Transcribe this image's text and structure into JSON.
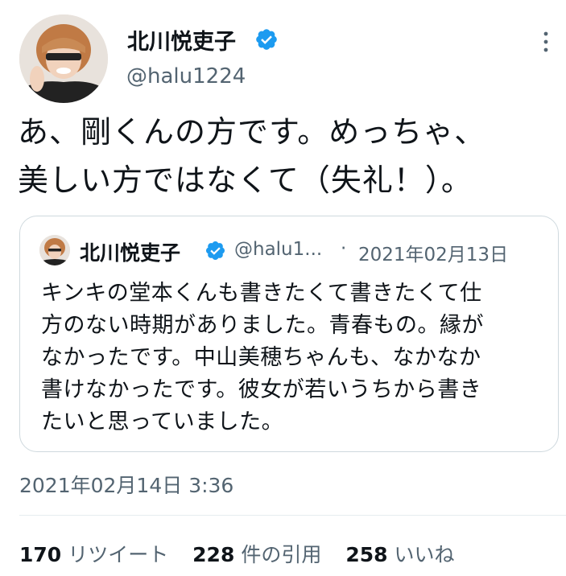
{
  "author": {
    "name": "北川悦吏子",
    "handle": "@halu1224",
    "verified": true
  },
  "tweet": {
    "lines": [
      "あ、剛くんの方です。めっちゃ、",
      "美しい方ではなくて（失礼！）。"
    ],
    "timestamp": "2021年02月14日 3:36"
  },
  "quoted_tweet": {
    "name": "北川悦吏子",
    "handle": "@halu1...",
    "separator": "·",
    "date": "2021年02月13日",
    "lines": [
      "キンキの堂本くんも書きたくて書きたくて仕",
      "方のない時期がありました。青春もの。縁が",
      "なかったです。中山美穂ちゃんも、なかなか",
      "書けなかったです。彼女が若いうちから書き",
      "たいと思っていました。"
    ]
  },
  "stats": [
    {
      "count": "170",
      "label": "リツイート"
    },
    {
      "count": "228",
      "label": "件の引用"
    },
    {
      "count": "258",
      "label": "いいね"
    }
  ],
  "colors": {
    "text": "#0f1419",
    "secondary": "#536471",
    "verified_badge": "#1d9bf0",
    "border": "#cfd9de"
  },
  "icons": {
    "verified": "verified-badge-icon",
    "more": "more-vertical-icon"
  }
}
